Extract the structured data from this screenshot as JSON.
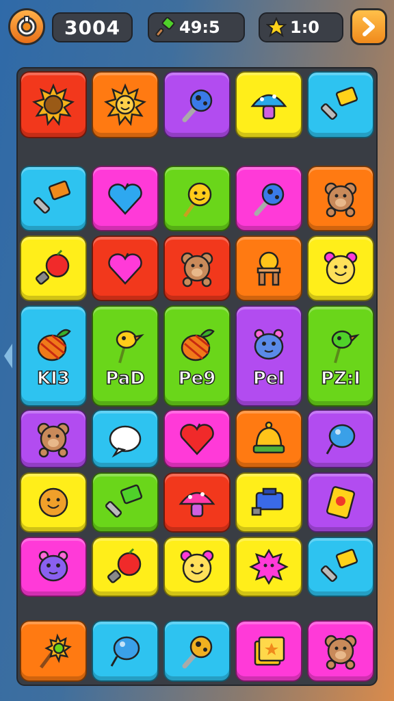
{
  "hud": {
    "score": "3004",
    "moves": "49:5",
    "stars": "1:0",
    "home_icon": "home-target-icon",
    "moves_icon": "green-hammer-icon",
    "stars_icon": "star-icon",
    "next_icon": "arrow-right-icon"
  },
  "colors": {
    "red": "#f2381c",
    "orange": "#ff7a12",
    "purple": "#b24cf0",
    "yellow": "#ffee1a",
    "cyan": "#2ec3f0",
    "magenta": "#ff3ad8",
    "green": "#6ad61a",
    "board": "#393d44"
  },
  "rows": [
    [
      {
        "color": "red",
        "icon": "sun-icon",
        "label": ""
      },
      {
        "color": "orange",
        "icon": "smiling-sun-icon",
        "label": ""
      },
      {
        "color": "purple",
        "icon": "blue-rattle-icon",
        "label": ""
      },
      {
        "color": "yellow",
        "icon": "mushroom-icon",
        "label": ""
      },
      {
        "color": "cyan",
        "icon": "yellow-hammer-icon",
        "label": ""
      }
    ],
    [
      {
        "color": "cyan",
        "icon": "orange-hammer-icon",
        "label": ""
      },
      {
        "color": "magenta",
        "icon": "blue-heart-icon",
        "label": ""
      },
      {
        "color": "green",
        "icon": "smiling-lollipop-icon",
        "label": ""
      },
      {
        "color": "magenta",
        "icon": "blue-ball-rattle-icon",
        "label": ""
      },
      {
        "color": "orange",
        "icon": "teddy-bear-icon",
        "label": ""
      }
    ],
    [
      {
        "color": "yellow",
        "icon": "apple-bomb-icon",
        "label": ""
      },
      {
        "color": "red",
        "icon": "pink-heart-icon",
        "label": ""
      },
      {
        "color": "red",
        "icon": "teddy-bear-icon",
        "label": ""
      },
      {
        "color": "orange",
        "icon": "yellow-ball-icon",
        "label": ""
      },
      {
        "color": "yellow",
        "icon": "smiling-flower-icon",
        "label": ""
      }
    ],
    [
      {
        "color": "cyan",
        "icon": "striped-fruit-icon",
        "label": "KI3"
      },
      {
        "color": "green",
        "icon": "yellow-bird-icon",
        "label": "PaD"
      },
      {
        "color": "green",
        "icon": "striped-fruit-icon",
        "label": "Pe9"
      },
      {
        "color": "purple",
        "icon": "blue-creature-icon",
        "label": "PeI"
      },
      {
        "color": "green",
        "icon": "green-bird-icon",
        "label": "PZ:I"
      }
    ],
    [
      {
        "color": "purple",
        "icon": "teddy-bear-icon",
        "label": ""
      },
      {
        "color": "cyan",
        "icon": "white-bubble-icon",
        "label": ""
      },
      {
        "color": "magenta",
        "icon": "red-heart-icon",
        "label": ""
      },
      {
        "color": "orange",
        "icon": "bell-icon",
        "label": ""
      },
      {
        "color": "purple",
        "icon": "blue-balloon-icon",
        "label": ""
      }
    ],
    [
      {
        "color": "yellow",
        "icon": "orange-face-icon",
        "label": ""
      },
      {
        "color": "green",
        "icon": "green-hammer-icon",
        "label": ""
      },
      {
        "color": "red",
        "icon": "pink-mushroom-icon",
        "label": ""
      },
      {
        "color": "yellow",
        "icon": "blue-block-icon",
        "label": ""
      },
      {
        "color": "purple",
        "icon": "yellow-card-icon",
        "label": ""
      }
    ],
    [
      {
        "color": "magenta",
        "icon": "purple-creature-icon",
        "label": ""
      },
      {
        "color": "yellow",
        "icon": "apple-bomb-icon",
        "label": ""
      },
      {
        "color": "yellow",
        "icon": "smiling-flower-icon",
        "label": ""
      },
      {
        "color": "yellow",
        "icon": "pink-spiky-icon",
        "label": ""
      },
      {
        "color": "cyan",
        "icon": "yellow-hammer-icon",
        "label": ""
      }
    ],
    [
      {
        "color": "orange",
        "icon": "sunflower-wand-icon",
        "label": ""
      },
      {
        "color": "cyan",
        "icon": "blue-balloon-icon",
        "label": ""
      },
      {
        "color": "cyan",
        "icon": "racket-icon",
        "label": ""
      },
      {
        "color": "magenta",
        "icon": "gift-box-icon",
        "label": ""
      },
      {
        "color": "magenta",
        "icon": "teddy-bear-icon",
        "label": ""
      }
    ]
  ]
}
